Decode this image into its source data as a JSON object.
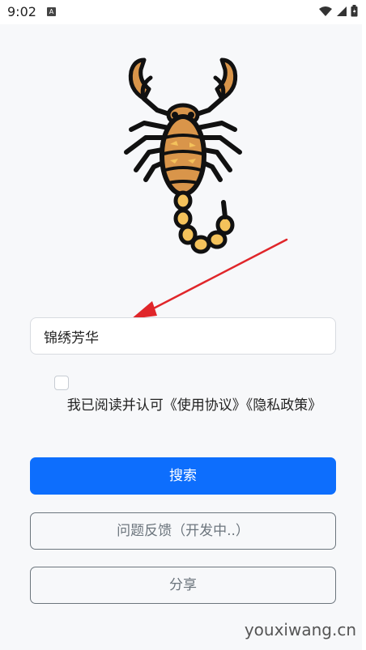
{
  "status_bar": {
    "time": "9:02",
    "notification_icon": "A"
  },
  "search": {
    "value": "锦绣芳华"
  },
  "agreement": {
    "text": "我已阅读并认可《使用协议》《隐私政策》",
    "checked": false
  },
  "buttons": {
    "search_label": "搜索",
    "feedback_label": "问题反馈（开发中..）",
    "share_label": "分享"
  },
  "watermark": "youxiwang.cn",
  "colors": {
    "primary": "#0d6efd",
    "outline": "#6c757d",
    "arrow": "#e0262a",
    "scorpion_body": "#d9954a",
    "scorpion_accent": "#f4c25b"
  },
  "icons": {
    "logo": "scorpion-icon",
    "status_wifi": "wifi-icon",
    "status_signal": "signal-icon",
    "status_battery": "battery-icon"
  }
}
